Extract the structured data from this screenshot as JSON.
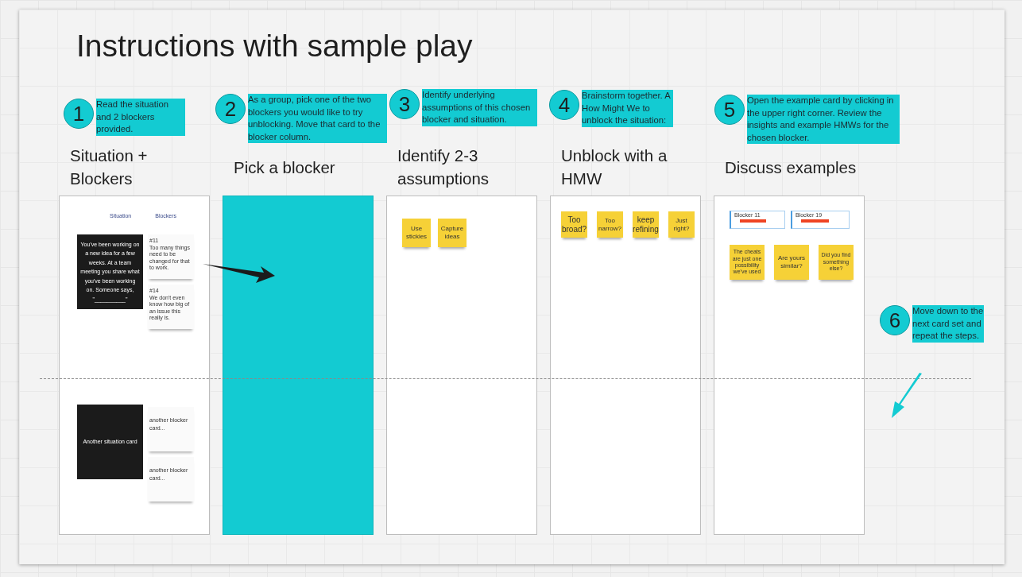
{
  "title": "Instructions with sample play",
  "steps": [
    {
      "number": "1",
      "text": "Read the situation and 2 blockers provided."
    },
    {
      "number": "2",
      "text": "As a group, pick one of the two blockers you would like to try unblocking. Move that card to the blocker column."
    },
    {
      "number": "3",
      "text": "Identify underlying assumptions of this chosen blocker and situation."
    },
    {
      "number": "4",
      "text": "Brainstorm together. A How Might We to unblock the situation:"
    },
    {
      "number": "5",
      "text": "Open the example card by clicking in the upper right corner. Review the insights and example HMWs for the chosen blocker."
    },
    {
      "number": "6",
      "text": "Move down to the next card set and repeat the steps."
    }
  ],
  "columns": [
    {
      "kind": "situations",
      "heading": "Situation + Blockers",
      "labels": [
        "Situation",
        "Blockers"
      ],
      "sets": [
        {
          "situation": "You've been working on a new idea for a few weeks. At a team meeting you share what you've been working on. Someone says, \"__________\"",
          "blockers": [
            {
              "number": "#11",
              "text": "Too many things need to be changed for that to work."
            },
            {
              "number": "#14",
              "text": "We don't even know how big of an issue this really is."
            }
          ]
        },
        {
          "situation": "Another situation card",
          "blockers": [
            {
              "text": "another blocker card..."
            },
            {
              "text": "another blocker card..."
            }
          ]
        }
      ]
    },
    {
      "kind": "fill",
      "heading": "Pick a blocker"
    },
    {
      "kind": "stickies",
      "heading": "Identify 2-3 assumptions",
      "stickies": [
        "Use stickies",
        "Capture ideas"
      ]
    },
    {
      "kind": "stickies",
      "heading": "Unblock with a HMW",
      "stickies": [
        "Too broad?",
        "Too narrow?",
        "keep refining",
        "Just right?"
      ]
    },
    {
      "kind": "examples",
      "heading": "Discuss examples",
      "tags": [
        "Blocker 11",
        "Blocker 19"
      ],
      "stickies": [
        "The cheats are just one possibility we've used",
        "Are yours similar?",
        "Did you find something else?"
      ]
    }
  ]
}
